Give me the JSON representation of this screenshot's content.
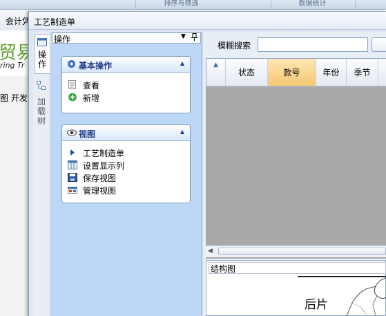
{
  "background_app": {
    "top_tabs": [
      "排序与筛选",
      "数据统计"
    ],
    "menu_label": "会计凭",
    "logo_big": "贸易",
    "logo_small": "ring Tr",
    "side_label": "图 开发"
  },
  "window": {
    "title": "工艺制造单"
  },
  "dock_tabs": [
    {
      "label": "操作",
      "icon": "panel-icon",
      "selected": true
    },
    {
      "label": "加载树",
      "icon": "tree-icon",
      "selected": false
    }
  ],
  "ops_panel": {
    "title": "操作",
    "dropdown_icon": "▼",
    "pin_icon": "ㄗ",
    "groups": [
      {
        "title": "基本操作",
        "collapse": "▲",
        "items": [
          {
            "label": "查看",
            "icon": "view-document-icon"
          },
          {
            "label": "新增",
            "icon": "add-icon"
          }
        ]
      },
      {
        "title": "视图",
        "collapse": "▲",
        "items": [
          {
            "label": "工艺制造单",
            "icon": "arrow-right-icon"
          },
          {
            "label": "设置显示列",
            "icon": "columns-icon"
          },
          {
            "label": "保存视图",
            "icon": "save-icon"
          },
          {
            "label": "管理视图",
            "icon": "manage-view-icon"
          }
        ]
      }
    ]
  },
  "search": {
    "label": "模糊搜索",
    "value": "",
    "placeholder": ""
  },
  "grid": {
    "corner": "▲",
    "columns": [
      "状态",
      "款号",
      "年份",
      "季节"
    ],
    "sorted_column": "款号"
  },
  "scroll": {
    "left_arrow": "◀"
  },
  "structure": {
    "title": "结构图",
    "label": "后片"
  },
  "colors": {
    "panel_bg": "#bdd7f7",
    "header_active": "#f6c873",
    "group_title": "#1f3c8c",
    "grid_empty": "#a9a9a9"
  }
}
